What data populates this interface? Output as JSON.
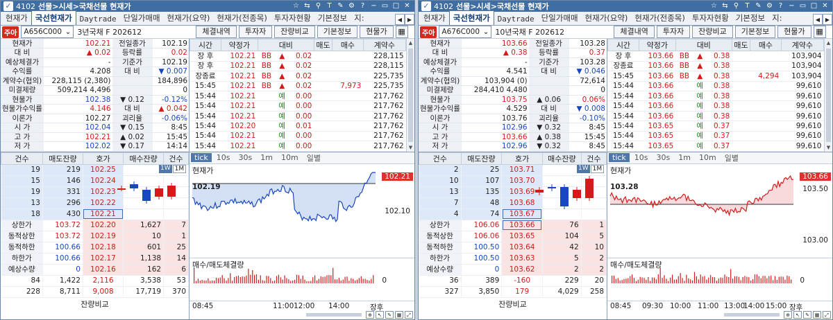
{
  "colors": {
    "up": "#d61a1a",
    "down": "#1646c0",
    "title_bar": "#3f6ea3"
  },
  "windows": [
    {
      "title": {
        "code": "4102",
        "path": "선물>시세>국채선물 현재가"
      },
      "tabs": [
        "현재가",
        "국선현재가",
        "Daytrade",
        "단일가매매",
        "현재가(요약)",
        "현재가(전종목)",
        "투자자현황",
        "기본정보",
        "지:"
      ],
      "toolbar": {
        "logo": "주아",
        "code": "A656C000",
        "name": "3년국채 F 202612",
        "buttons": [
          "체결내역",
          "투자자",
          "잔량비교",
          "기본정보",
          "현물가"
        ]
      },
      "info": [
        {
          "l1": "현재가",
          "v1": "102.21",
          "c1": "r",
          "l2": "전일종가",
          "v2": "102.19",
          "c2": ""
        },
        {
          "l1": "대  비",
          "v1": "▲   0.02",
          "c1": "r",
          "l2": "등락률",
          "v2": "0.02",
          "c2": "r"
        },
        {
          "l1": "예상체결가",
          "v1": "-",
          "c1": "",
          "l2": "기준가",
          "v2": "102.19",
          "c2": ""
        },
        {
          "l1": "수익률",
          "v1": "4.208",
          "c1": "",
          "l2": "대  비",
          "v2": "▼  0.007",
          "c2": "b"
        },
        {
          "l1": "계약수(협의)",
          "v1": "228,115   (2,380)",
          "c1": "",
          "l2": "",
          "v2": "184,896",
          "c2": ""
        },
        {
          "l1": "미결제량",
          "v1": "509,214   4,496",
          "c1": "",
          "l2": "",
          "v2": "0",
          "c2": ""
        },
        {
          "l1": "현물가",
          "v1": "102.38",
          "c1": "b",
          "l2": "▼ 0.12",
          "v2": "-0.12%",
          "c2": "b"
        },
        {
          "l1": "현물가수익률",
          "v1": "4.146",
          "c1": "r",
          "l2": "대  비",
          "v2": "▲  0.042",
          "c2": "r"
        },
        {
          "l1": "이론가",
          "v1": "102.27",
          "c1": "",
          "l2": "괴리율",
          "v2": "-0.06%",
          "c2": "b"
        },
        {
          "l1": "시   가",
          "v1": "102.04",
          "c1": "b",
          "l2": "▼  0.15",
          "v2": "8:45",
          "c2": ""
        },
        {
          "l1": "고   가",
          "v1": "102.21",
          "c1": "r",
          "l2": "▲  0.02",
          "v2": "15:45",
          "c2": ""
        },
        {
          "l1": "저   가",
          "v1": "102.02",
          "c1": "b",
          "l2": "▼  0.17",
          "v2": "14:14",
          "c2": ""
        }
      ],
      "ticks_head": [
        "시간",
        "약정가",
        "대비",
        "매도",
        "매수",
        "계약수"
      ],
      "ticks": [
        [
          "장 후",
          "102.21",
          "BB",
          "▲",
          "0.02",
          "",
          "",
          "228,115"
        ],
        [
          "장 후",
          "102.21",
          "BB",
          "▲",
          "0.02",
          "",
          "",
          "228,115"
        ],
        [
          "장종료",
          "102.21",
          "BB",
          "▲",
          "0.02",
          "",
          "",
          "225,735"
        ],
        [
          "15:45",
          "102.21",
          "BB",
          "▲",
          "0.02",
          "",
          "7,973",
          "225,735"
        ],
        [
          "15:44",
          "102.21",
          "",
          "예",
          "0.00",
          "",
          "",
          "217,762"
        ],
        [
          "15:44",
          "102.21",
          "",
          "예",
          "0.00",
          "",
          "",
          "217,762"
        ],
        [
          "15:44",
          "102.21",
          "",
          "예",
          "0.00",
          "",
          "",
          "217,762"
        ],
        [
          "15:44",
          "102.20",
          "",
          "예",
          "0.01",
          "",
          "",
          "217,762"
        ],
        [
          "15:44",
          "102.21",
          "",
          "예",
          "0.00",
          "",
          "",
          "217,762"
        ],
        [
          "15:44",
          "102.21",
          "",
          "예",
          "0.00",
          "",
          "",
          "217,762"
        ]
      ],
      "ob_head": [
        "건수",
        "매도잔량",
        "호가",
        "매수잔량",
        "건수"
      ],
      "asks": [
        [
          "19",
          "219",
          "102.25"
        ],
        [
          "15",
          "146",
          "102.24"
        ],
        [
          "19",
          "331",
          "102.23"
        ],
        [
          "13",
          "296",
          "102.22"
        ],
        [
          "18",
          "430",
          "102.21"
        ]
      ],
      "mid": [
        {
          "lbl": "상한가",
          "a": "103.72",
          "p": "102.20",
          "q": "1,627",
          "n": "7"
        },
        {
          "lbl": "동적상한",
          "a": "103.72",
          "p": "102.19",
          "q": "10",
          "n": "1"
        },
        {
          "lbl": "동적하한",
          "a": "100.66",
          "p": "102.18",
          "q": "601",
          "n": "25"
        },
        {
          "lbl": "하한가",
          "a": "100.66",
          "p": "102.17",
          "q": "1,138",
          "n": "14"
        },
        {
          "lbl": "예상수량",
          "a": "0",
          "p": "102.16",
          "q": "162",
          "n": "6"
        }
      ],
      "totals": [
        [
          "84",
          "1,422",
          "2,116",
          "3,538",
          "53"
        ],
        [
          "228",
          "8,711",
          "9,008",
          "17,719",
          "370"
        ]
      ],
      "footer": "잔량비교",
      "chart_tabs": [
        "tick",
        "10s",
        "30s",
        "1m",
        "10m",
        "일별"
      ],
      "modes": [
        "1W",
        "1M"
      ],
      "chart_data": {
        "type": "line",
        "title": "현재가",
        "current": "102.21",
        "ref": "102.19",
        "ylabel_mid": "102.10",
        "x_ticks": [
          "08:45",
          "11:00",
          "12:00",
          "14:00",
          "장후"
        ],
        "vol_title": "매수/매도체결량",
        "vol_zero": "0",
        "pattern": "a"
      }
    },
    {
      "title": {
        "code": "4102",
        "path": "선물>시세>국채선물 현재가"
      },
      "tabs": [
        "현재가",
        "국선현재가",
        "Daytrade",
        "단일가매매",
        "현재가(요약)",
        "현재가(전종목)",
        "투자자현황",
        "기본정보",
        "지:"
      ],
      "toolbar": {
        "logo": "주아",
        "code": "A676C000",
        "name": "10년국채 F 202612",
        "buttons": [
          "체결내역",
          "투자자",
          "잔량비교",
          "기본정보",
          "현물가"
        ]
      },
      "info": [
        {
          "l1": "현재가",
          "v1": "103.66",
          "c1": "r",
          "l2": "전일종가",
          "v2": "103.28",
          "c2": ""
        },
        {
          "l1": "대  비",
          "v1": "▲   0.38",
          "c1": "r",
          "l2": "등락률",
          "v2": "0.37",
          "c2": "r"
        },
        {
          "l1": "예상체결가",
          "v1": "-",
          "c1": "",
          "l2": "기준가",
          "v2": "103.28",
          "c2": ""
        },
        {
          "l1": "수익률",
          "v1": "4.541",
          "c1": "",
          "l2": "대  비",
          "v2": "▼  0.046",
          "c2": "b"
        },
        {
          "l1": "계약수(협의)",
          "v1": "103,904   (0)",
          "c1": "",
          "l2": "",
          "v2": "72,614",
          "c2": ""
        },
        {
          "l1": "미결제량",
          "v1": "284,410   4,480",
          "c1": "",
          "l2": "",
          "v2": "0",
          "c2": ""
        },
        {
          "l1": "현물가",
          "v1": "103.75",
          "c1": "r",
          "l2": "▲ 0.06",
          "v2": "0.06%",
          "c2": "r"
        },
        {
          "l1": "현물가수익률",
          "v1": "4.529",
          "c1": "",
          "l2": "대  비",
          "v2": "▼  0.008",
          "c2": "b"
        },
        {
          "l1": "이론가",
          "v1": "103.76",
          "c1": "",
          "l2": "괴리율",
          "v2": "-0.10%",
          "c2": "b"
        },
        {
          "l1": "시   가",
          "v1": "102.96",
          "c1": "b",
          "l2": "▼  0.32",
          "v2": "8:45",
          "c2": ""
        },
        {
          "l1": "고   가",
          "v1": "103.66",
          "c1": "r",
          "l2": "▲  0.38",
          "v2": "15:45",
          "c2": ""
        },
        {
          "l1": "저   가",
          "v1": "102.96",
          "c1": "b",
          "l2": "▼  0.32",
          "v2": "8:45",
          "c2": ""
        }
      ],
      "ticks_head": [
        "시간",
        "약정가",
        "대비",
        "매도",
        "매수",
        "계약수"
      ],
      "ticks": [
        [
          "장 후",
          "103.66",
          "BB",
          "▲",
          "0.38",
          "",
          "",
          "103,904"
        ],
        [
          "장종료",
          "103.66",
          "BB",
          "▲",
          "0.38",
          "",
          "",
          "103,904"
        ],
        [
          "15:45",
          "103.66",
          "BB",
          "▲",
          "0.38",
          "",
          "4,294",
          "103,904"
        ],
        [
          "15:44",
          "103.66",
          "",
          "예",
          "0.38",
          "",
          "",
          "99,610"
        ],
        [
          "15:44",
          "103.66",
          "",
          "예",
          "0.38",
          "",
          "",
          "99,610"
        ],
        [
          "15:44",
          "103.66",
          "",
          "예",
          "0.38",
          "",
          "",
          "99,610"
        ],
        [
          "15:44",
          "103.66",
          "",
          "예",
          "0.38",
          "",
          "",
          "99,610"
        ],
        [
          "15:44",
          "103.65",
          "",
          "예",
          "0.37",
          "",
          "",
          "99,610"
        ],
        [
          "15:44",
          "103.65",
          "",
          "예",
          "0.37",
          "",
          "",
          "99,610"
        ],
        [
          "15:44",
          "103.65",
          "",
          "예",
          "0.37",
          "",
          "",
          "99,610"
        ]
      ],
      "ob_head": [
        "건수",
        "매도잔량",
        "호가",
        "매수잔량",
        "건수"
      ],
      "asks": [
        [
          "2",
          "25",
          "103.71"
        ],
        [
          "10",
          "107",
          "103.70"
        ],
        [
          "13",
          "135",
          "103.69"
        ],
        [
          "7",
          "48",
          "103.68"
        ],
        [
          "4",
          "74",
          "103.67"
        ]
      ],
      "mid": [
        {
          "lbl": "상한가",
          "a": "106.06",
          "p": "103.66",
          "q": "76",
          "n": "1"
        },
        {
          "lbl": "동적상한",
          "a": "106.06",
          "p": "103.65",
          "q": "104",
          "n": "5"
        },
        {
          "lbl": "동적하한",
          "a": "100.50",
          "p": "103.64",
          "q": "42",
          "n": "10"
        },
        {
          "lbl": "하한가",
          "a": "100.50",
          "p": "103.63",
          "q": "5",
          "n": "2"
        },
        {
          "lbl": "예상수량",
          "a": "0",
          "p": "103.62",
          "q": "2",
          "n": "2"
        }
      ],
      "totals": [
        [
          "36",
          "389",
          "-160",
          "229",
          "20"
        ],
        [
          "327",
          "3,850",
          "179",
          "4,029",
          "258"
        ]
      ],
      "footer": "잔량비교",
      "chart_tabs": [
        "tick",
        "10s",
        "30s",
        "1m",
        "10m",
        "일별"
      ],
      "modes": [
        "1W",
        "1M"
      ],
      "chart_data": {
        "type": "line",
        "title": "현재가",
        "current": "103.66",
        "ref": "103.28",
        "ylabel_top": "103.50",
        "ylabel_bot": "103.00",
        "x_ticks": [
          "08:45",
          "09:30",
          "10:00",
          "11:00",
          "13:00",
          "14:00",
          "15:00",
          "장후"
        ],
        "vol_title": "매수/매도체결량",
        "vol_zero": "0",
        "pattern": "b"
      }
    }
  ]
}
